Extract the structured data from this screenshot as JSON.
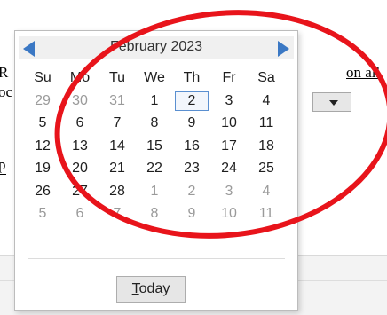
{
  "background": {
    "text_r": "R",
    "text_oc": "oc",
    "text_p": "p",
    "text_on_all": "on all"
  },
  "calendar": {
    "month_title": "February 2023",
    "weekdays": [
      "Su",
      "Mo",
      "Tu",
      "We",
      "Th",
      "Fr",
      "Sa"
    ],
    "weeks": [
      [
        {
          "d": "29",
          "o": true
        },
        {
          "d": "30",
          "o": true
        },
        {
          "d": "31",
          "o": true
        },
        {
          "d": "1"
        },
        {
          "d": "2",
          "sel": true
        },
        {
          "d": "3"
        },
        {
          "d": "4"
        }
      ],
      [
        {
          "d": "5"
        },
        {
          "d": "6"
        },
        {
          "d": "7"
        },
        {
          "d": "8"
        },
        {
          "d": "9"
        },
        {
          "d": "10"
        },
        {
          "d": "11"
        }
      ],
      [
        {
          "d": "12"
        },
        {
          "d": "13"
        },
        {
          "d": "14"
        },
        {
          "d": "15"
        },
        {
          "d": "16"
        },
        {
          "d": "17"
        },
        {
          "d": "18"
        }
      ],
      [
        {
          "d": "19"
        },
        {
          "d": "20"
        },
        {
          "d": "21"
        },
        {
          "d": "22"
        },
        {
          "d": "23"
        },
        {
          "d": "24"
        },
        {
          "d": "25"
        }
      ],
      [
        {
          "d": "26"
        },
        {
          "d": "27"
        },
        {
          "d": "28"
        },
        {
          "d": "1",
          "o": true
        },
        {
          "d": "2",
          "o": true
        },
        {
          "d": "3",
          "o": true
        },
        {
          "d": "4",
          "o": true
        }
      ],
      [
        {
          "d": "5",
          "o": true
        },
        {
          "d": "6",
          "o": true
        },
        {
          "d": "7",
          "o": true
        },
        {
          "d": "8",
          "o": true
        },
        {
          "d": "9",
          "o": true
        },
        {
          "d": "10",
          "o": true
        },
        {
          "d": "11",
          "o": true
        }
      ]
    ],
    "today_first": "T",
    "today_rest": "oday",
    "nav_color": "#3b78c4",
    "selected_border_color": "#5a8fd0"
  },
  "annotation": {
    "ellipse_color": "#e8141b"
  }
}
